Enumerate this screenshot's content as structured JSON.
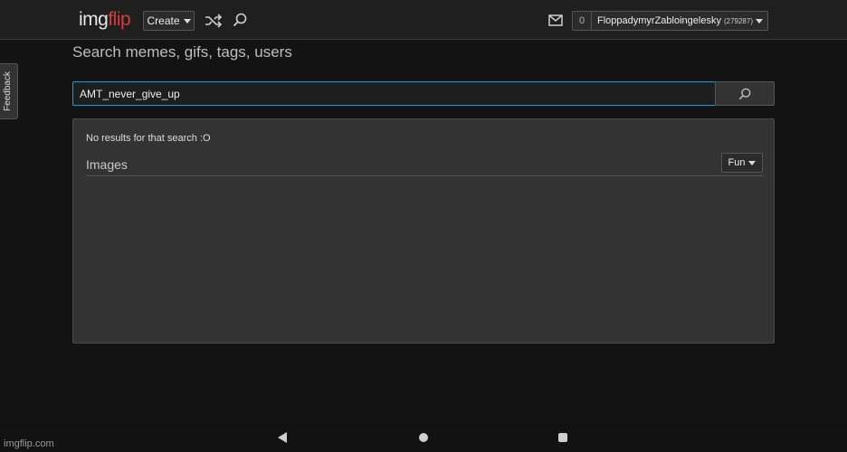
{
  "header": {
    "logo_part1": "img",
    "logo_part2": "flip",
    "create_label": "Create",
    "notifications_count": "0",
    "username": "FloppadymyrZabloingelesky",
    "user_points": "(279287)"
  },
  "sidebar": {
    "feedback_label": "Feedback"
  },
  "search": {
    "title": "Search memes, gifs, tags, users",
    "query": "AMT_never_give_up"
  },
  "results": {
    "message": "No results for that search :O",
    "section_title": "Images",
    "filter_label": "Fun"
  },
  "footer": {
    "watermark": "imgflip.com"
  },
  "colors": {
    "background": "#131313",
    "topbar": "#1f1f1f",
    "panel": "#333333",
    "accent_logo": "#d93a3a",
    "input_focus": "#3b8fb8"
  },
  "icons": [
    "shuffle-icon",
    "search-icon",
    "mail-icon",
    "chevron-down-icon",
    "nav-back-icon",
    "nav-home-icon",
    "nav-recent-icon"
  ]
}
